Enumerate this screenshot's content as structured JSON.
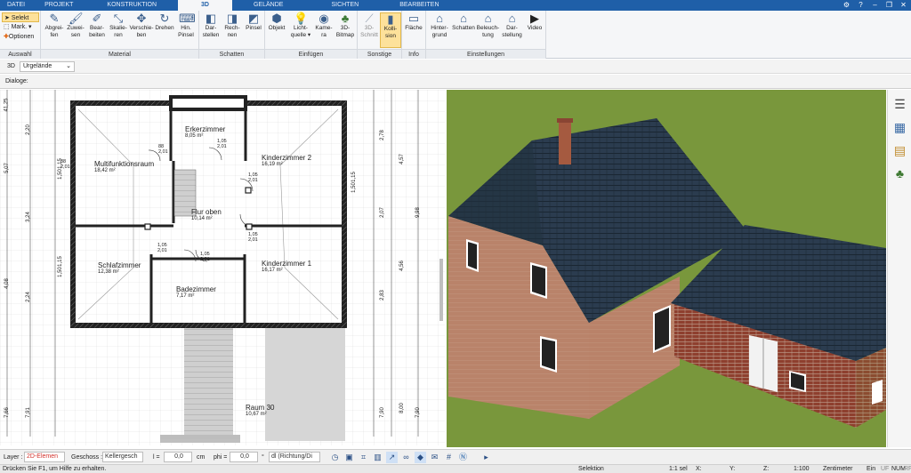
{
  "tabs": [
    "DATEI",
    "PROJEKT",
    "KONSTRUKTION",
    "3D",
    "GELÄNDE",
    "SICHTEN",
    "BEARBEITEN"
  ],
  "active_tab": "3D",
  "ribbon": {
    "auswahl": {
      "title": "Auswahl",
      "items": [
        "Selekt",
        "Mark.",
        "Optionen"
      ]
    },
    "material": {
      "title": "Material",
      "buttons": [
        "Abgrei-\nfen",
        "Zuwei-\nsen",
        "Bear-\nbeiten",
        "Skalie-\nren",
        "Verschie-\nben",
        "Drehen",
        "Hin.\nPinsel"
      ]
    },
    "schatten": {
      "title": "Schatten",
      "buttons": [
        "Dar-\nstellen",
        "Rech-\nnen",
        "Pinsel"
      ]
    },
    "einfuegen": {
      "title": "Einfügen",
      "buttons": [
        "Objekt",
        "Licht-\nquelle ▾",
        "Kame-\nra",
        "3D-\nBitmap"
      ]
    },
    "sonstige": {
      "title": "Sonstige",
      "buttons": [
        "3D-\nSchnitt",
        "Kolli-\nsion"
      ]
    },
    "info": {
      "title": "Info",
      "buttons": [
        "Fläche"
      ]
    },
    "einstellungen": {
      "title": "Einstellungen",
      "buttons": [
        "Hinter-\ngrund",
        "Schatten",
        "Beleuch-\ntung",
        "Dar-\nstellung",
        "Video"
      ]
    }
  },
  "viewbar": {
    "mode": "3D",
    "terrain": "Urgelände"
  },
  "dialogbar": {
    "label": "Dialoge:"
  },
  "plan": {
    "rooms": [
      {
        "name": "Erkerzimmer",
        "area": "8,05 m²"
      },
      {
        "name": "Multifunktionsraum",
        "area": "18,42 m²"
      },
      {
        "name": "Kinderzimmer 2",
        "area": "16,19 m²"
      },
      {
        "name": "Flur oben",
        "area": "10,14 m²"
      },
      {
        "name": "Schlafzimmer",
        "area": "12,38 m²"
      },
      {
        "name": "Kinderzimmer 1",
        "area": "16,17 m²"
      },
      {
        "name": "Badezimmer",
        "area": "7,17 m²"
      },
      {
        "name": "Raum 30",
        "area": "10,67 m²"
      }
    ],
    "door_labels": [
      "1,05\n2,01",
      "1,05\n2,01",
      "1,05\n2,01",
      "1,05\n2,01",
      "1,05\n2,01",
      "88\n2,01",
      "88\n2,01"
    ],
    "dims_left": [
      "2,20",
      "5,07",
      "3,24",
      "4,08",
      "2,24",
      "7,66",
      "7,91",
      "1,15",
      "1,50",
      "1,15",
      "1,50",
      "41,25"
    ],
    "dims_right": [
      "2,78",
      "4,57",
      "2,07",
      "9,98",
      "4,56",
      "2,83",
      "8,00",
      "7,90",
      "7,90",
      "1,15",
      "1,50"
    ]
  },
  "bottombar": {
    "layer_label": "Layer :",
    "layer_value": "2D-Elemen",
    "geschoss_label": "Geschoss :",
    "geschoss_value": "Kellergesch",
    "l_label": "l =",
    "l_value": "0,0",
    "l_unit": "cm",
    "phi_label": "phi =",
    "phi_value": "0,0",
    "phi_unit": "°",
    "direction_value": "dl (Richtung/Di"
  },
  "statusbar": {
    "help": "Drücken Sie F1, um Hilfe zu erhalten.",
    "mode": "Selektion",
    "sel": "1:1 sel",
    "x": "X:",
    "y": "Y:",
    "z": "Z:",
    "scale": "1:100",
    "unit": "Zentimeter",
    "ein": "Ein",
    "uf": "UF",
    "num": "NUM",
    "rf": "RF"
  },
  "colors": {
    "accent": "#1f5fa8",
    "roof": "#27384a",
    "brick": "#b07b5c",
    "lawn": "#7a9a3c"
  }
}
